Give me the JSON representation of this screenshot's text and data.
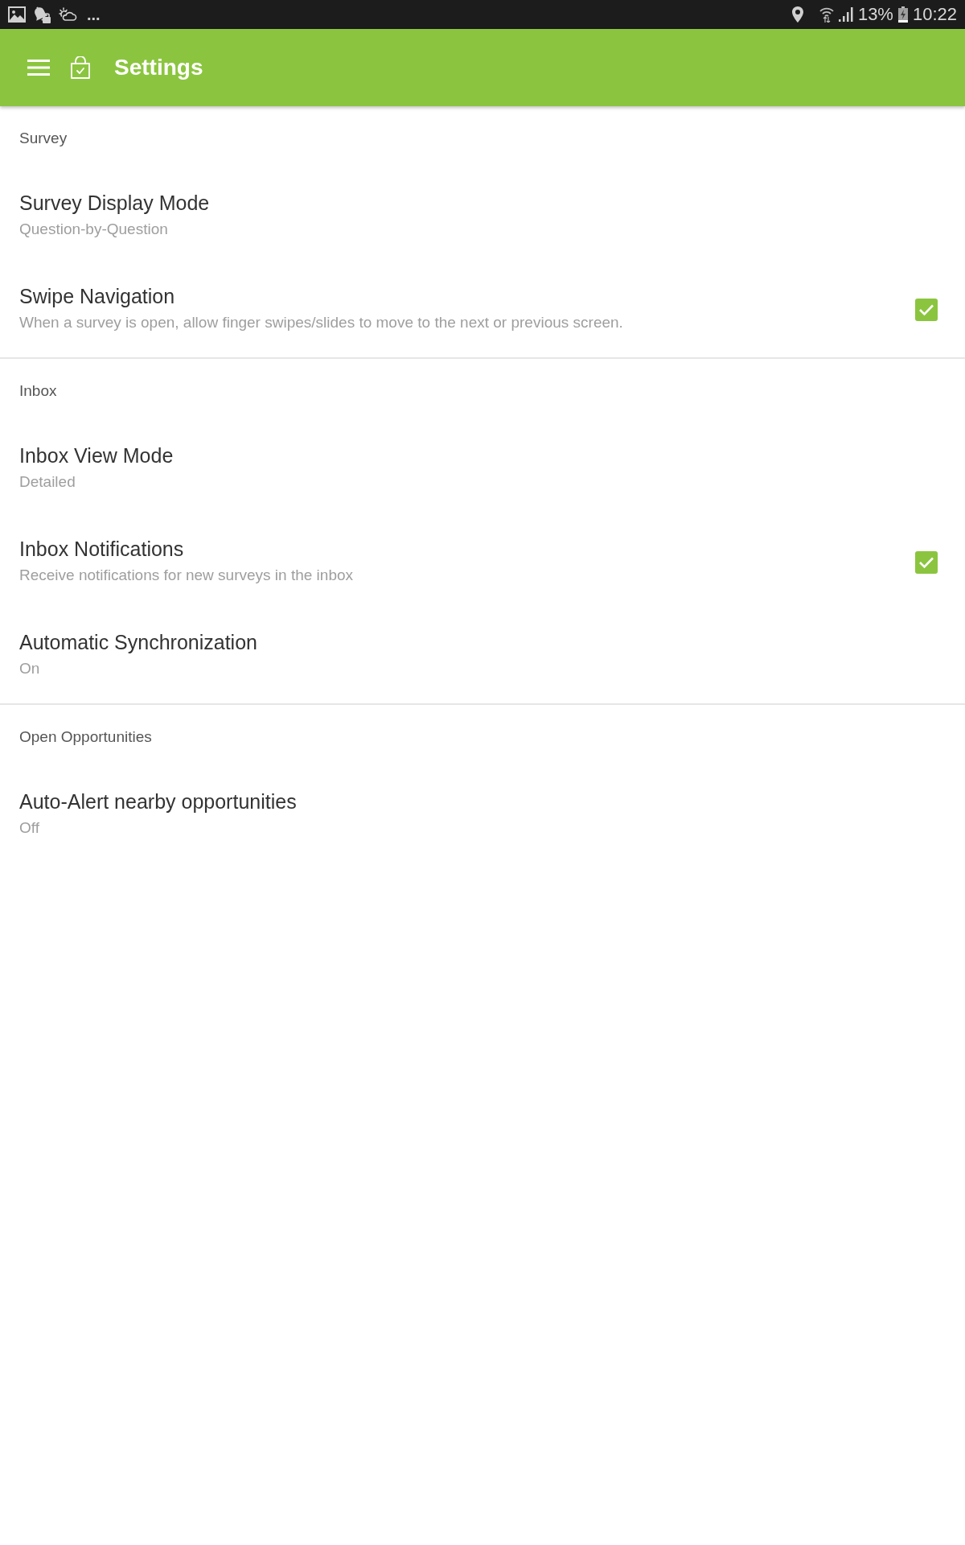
{
  "status_bar": {
    "overflow": "...",
    "battery_percent": "13%",
    "time": "10:22"
  },
  "app_bar": {
    "title": "Settings"
  },
  "sections": [
    {
      "header": "Survey",
      "items": [
        {
          "kind": "value",
          "title": "Survey Display Mode",
          "summary": "Question-by-Question"
        },
        {
          "kind": "checkbox",
          "title": "Swipe Navigation",
          "summary": "When a survey is open, allow finger swipes/slides to move to the next or previous screen.",
          "checked": true
        }
      ]
    },
    {
      "header": "Inbox",
      "items": [
        {
          "kind": "value",
          "title": "Inbox View Mode",
          "summary": "Detailed"
        },
        {
          "kind": "checkbox",
          "title": "Inbox Notifications",
          "summary": "Receive notifications for new surveys in the inbox",
          "checked": true
        },
        {
          "kind": "value",
          "title": "Automatic Synchronization",
          "summary": "On"
        }
      ]
    },
    {
      "header": "Open Opportunities",
      "items": [
        {
          "kind": "value",
          "title": "Auto-Alert nearby opportunities",
          "summary": "Off"
        }
      ]
    }
  ]
}
